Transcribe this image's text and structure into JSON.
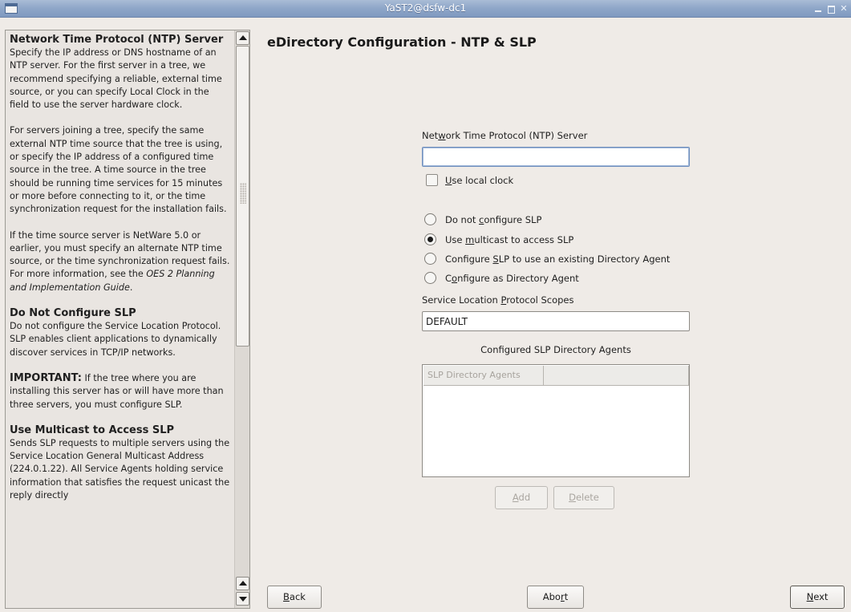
{
  "window": {
    "title": "YaST2@dsfw-dc1"
  },
  "help": {
    "sections": [
      {
        "heading": "Network Time Protocol (NTP) Server"
      },
      {
        "heading": "Do Not Configure SLP"
      },
      {
        "heading": "Use Multicast to Access SLP"
      }
    ],
    "p1": "Specify the IP address or DNS hostname of an NTP server. For the first server in a tree, we recommend specifying a reliable, external time source, or you can specify Local Clock in the field to use the server hardware clock.",
    "p2": "For servers joining a tree, specify the same external NTP time source that the tree is using, or specify the IP address of a configured time source in the tree. A time source in the tree should be running time services for 15 minutes or more before connecting to it, or the time synchronization request for the installation fails.",
    "p3": "If the time source server is NetWare 5.0 or earlier, you must specify an alternate NTP time source, or the time synchronization request fails. For more information, see the",
    "p3_link": "OES 2 Planning and Implementation Guide",
    "p3_end": ".",
    "p4": "Do not configure the Service Location Protocol. SLP enables client applications to dynamically discover services in TCP/IP networks.",
    "important_label": "IMPORTANT:",
    "important_text": " If the tree where you are installing this server has or will have more than three servers, you must configure SLP.",
    "p5": "Sends SLP requests to multiple servers using the Service Location General Multicast Address (224.0.1.22). All Service Agents holding service information that satisfies the request unicast the reply directly"
  },
  "main": {
    "heading": "eDirectory Configuration - NTP & SLP",
    "ntp_label_a": "Net",
    "ntp_label_u": "w",
    "ntp_label_b": "ork Time Protocol (NTP) Server",
    "ntp_value": "",
    "use_local_clock_u": "U",
    "use_local_clock_rest": "se local clock",
    "use_local_clock_checked": false,
    "radios": [
      {
        "pre": "Do not ",
        "u": "c",
        "post": "onfigure SLP",
        "checked": false
      },
      {
        "pre": "Use ",
        "u": "m",
        "post": "ulticast to access SLP",
        "checked": true
      },
      {
        "pre": "Configure ",
        "u": "S",
        "post": "LP to use an existing Directory Agent",
        "checked": false
      },
      {
        "pre": "C",
        "u": "o",
        "post": "nfigure as Directory Agent",
        "checked": false
      }
    ],
    "scopes_label_a": "Service Location ",
    "scopes_label_u": "P",
    "scopes_label_b": "rotocol Scopes",
    "scopes_value": "DEFAULT",
    "agents_title": "Configured SLP Directory Agents",
    "agents_columns": [
      "SLP Directory Agents",
      ""
    ],
    "agents_rows": [],
    "add_u": "A",
    "add_rest": "dd",
    "delete_u": "D",
    "delete_rest": "elete"
  },
  "footer": {
    "back_u": "B",
    "back_rest": "ack",
    "abort_a": "Abo",
    "abort_u": "r",
    "abort_b": "t",
    "next_u": "N",
    "next_rest": "ext"
  }
}
